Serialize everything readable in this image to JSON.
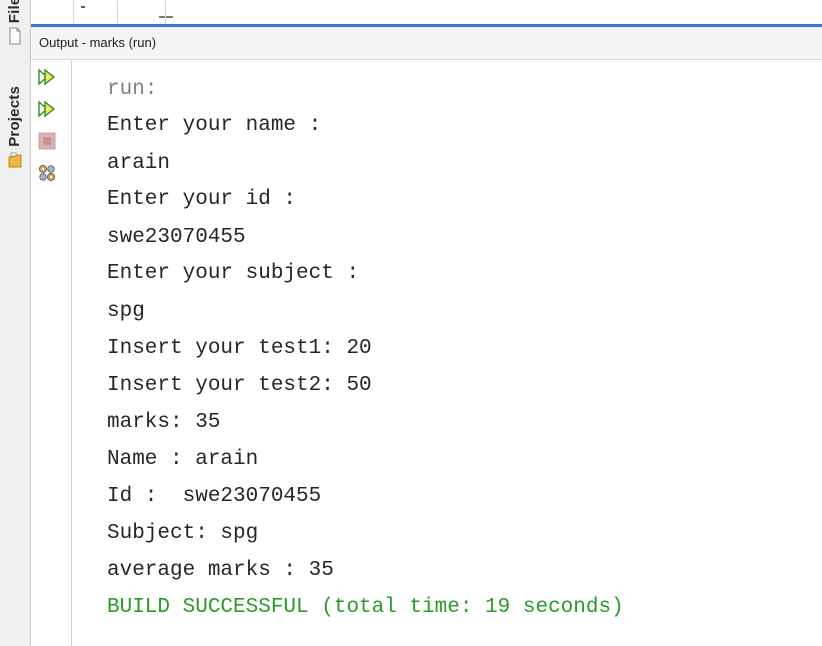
{
  "side_tabs": [
    {
      "label": "Files",
      "icon": "file-icon"
    },
    {
      "label": "Projects",
      "icon": "folder-icon"
    }
  ],
  "output": {
    "title": "Output - marks (run)"
  },
  "toolbar": {
    "buttons": [
      {
        "name": "rerun-icon"
      },
      {
        "name": "rerun-with-parameters-icon"
      },
      {
        "name": "stop-icon"
      },
      {
        "name": "settings-icon"
      }
    ]
  },
  "console": {
    "lines": [
      {
        "text": "run:",
        "kind": "muted"
      },
      {
        "text": "Enter your name :",
        "kind": "normal"
      },
      {
        "text": "arain",
        "kind": "normal"
      },
      {
        "text": "Enter your id :",
        "kind": "normal"
      },
      {
        "text": "swe23070455",
        "kind": "normal"
      },
      {
        "text": "Enter your subject :",
        "kind": "normal"
      },
      {
        "text": "spg",
        "kind": "normal"
      },
      {
        "text": "Insert your test1: 20",
        "kind": "normal"
      },
      {
        "text": "Insert your test2: 50",
        "kind": "normal"
      },
      {
        "text": "marks: 35",
        "kind": "normal"
      },
      {
        "text": "Name : arain",
        "kind": "normal"
      },
      {
        "text": "Id :  swe23070455",
        "kind": "normal"
      },
      {
        "text": "Subject: spg",
        "kind": "normal"
      },
      {
        "text": "average marks : 35",
        "kind": "normal"
      },
      {
        "text": "BUILD SUCCESSFUL (total time: 19 seconds)",
        "kind": "success"
      }
    ]
  },
  "colors": {
    "accent": "#3e78c8",
    "success": "#2b9a2b",
    "muted": "#808080",
    "text": "#262626"
  }
}
